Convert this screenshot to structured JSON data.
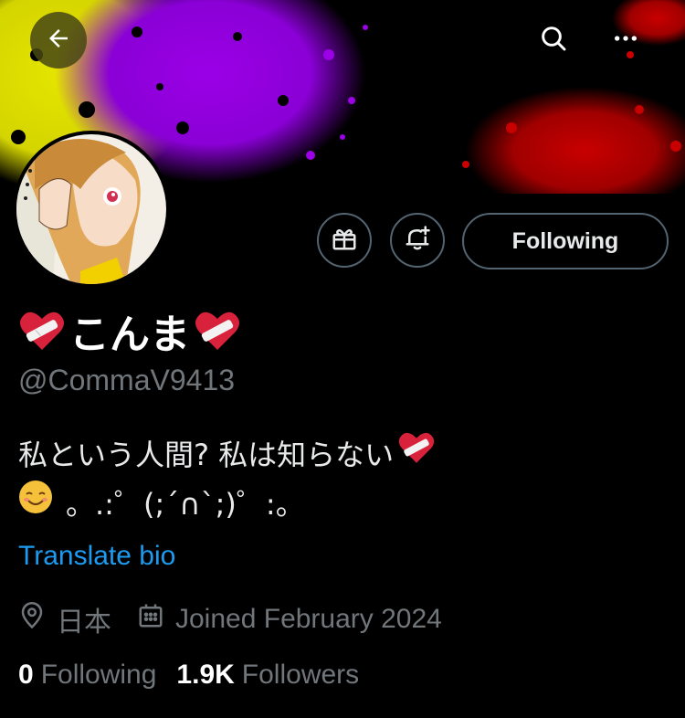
{
  "header": {
    "back_icon": "arrow-left-icon",
    "search_icon": "search-icon",
    "more_icon": "more-horizontal-icon",
    "banner_colors": [
      "#e6e600",
      "#9b00e6",
      "#c80000"
    ]
  },
  "profile": {
    "display_name": "こんま",
    "name_emoji": "mending-heart-icon",
    "handle": "@CommaV9413",
    "bio_line1": "私という人間?  私は知らない",
    "bio_line2": "。.:゜(;´∩`;)゜:。",
    "bio_emoji2": "smiling-face-icon",
    "translate_label": "Translate bio",
    "location": "日本",
    "joined": "Joined February 2024"
  },
  "actions": {
    "gift_icon": "gift-icon",
    "notify_icon": "bell-plus-icon",
    "following_label": "Following"
  },
  "stats": {
    "following_count": "0",
    "following_label": "Following",
    "followers_count": "1.9K",
    "followers_label": "Followers"
  },
  "colors": {
    "link": "#1d9bf0",
    "secondary_text": "#71767b",
    "border": "#536471"
  }
}
